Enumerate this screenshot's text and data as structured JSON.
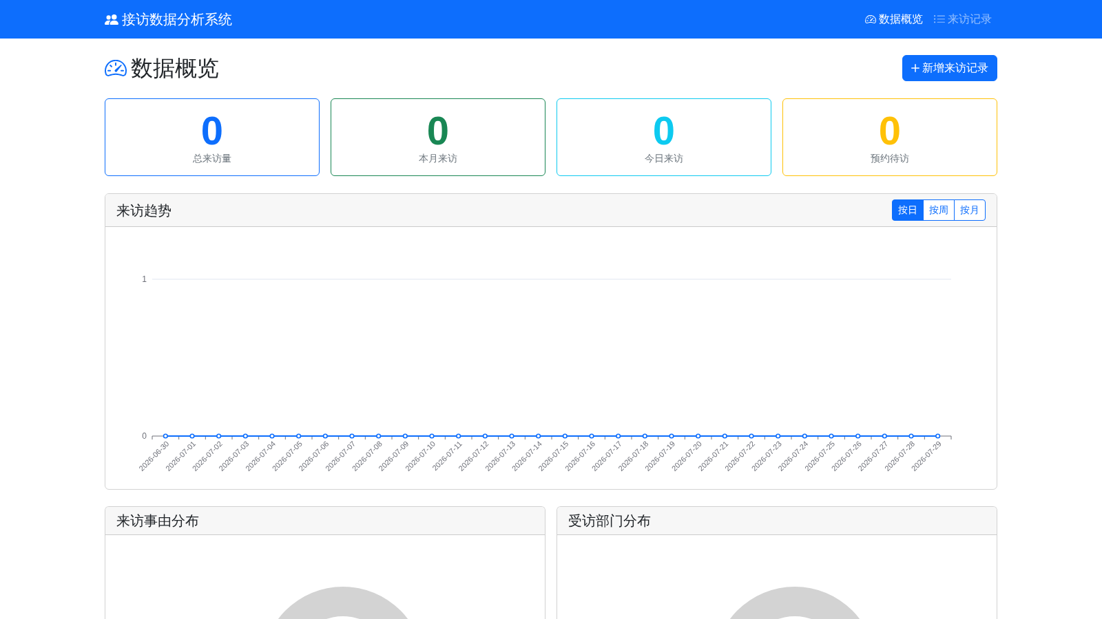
{
  "navbar": {
    "brand": "接访数据分析系统",
    "links": [
      {
        "label": "数据概览",
        "selected": true
      },
      {
        "label": "来访记录",
        "selected": false
      }
    ]
  },
  "page_header": {
    "title": "数据概览",
    "button": "新增来访记录"
  },
  "stats": [
    {
      "value": "0",
      "label": "总来访量",
      "color": "#0d6efd"
    },
    {
      "value": "0",
      "label": "本月来访",
      "color": "#198754"
    },
    {
      "value": "0",
      "label": "今日来访",
      "color": "#0dcaf0"
    },
    {
      "value": "0",
      "label": "预约待访",
      "color": "#ffc107"
    }
  ],
  "trend_card": {
    "title": "来访趋势",
    "ranges": [
      {
        "label": "按日",
        "selected": true
      },
      {
        "label": "按周",
        "selected": false
      },
      {
        "label": "按月",
        "selected": false
      }
    ],
    "chart_data": {
      "type": "line",
      "categories": [
        "2026-06-30",
        "2026-07-01",
        "2026-07-02",
        "2026-07-03",
        "2026-07-04",
        "2026-07-05",
        "2026-07-06",
        "2026-07-07",
        "2026-07-08",
        "2026-07-09",
        "2026-07-10",
        "2026-07-11",
        "2026-07-12",
        "2026-07-13",
        "2026-07-14",
        "2026-07-15",
        "2026-07-16",
        "2026-07-17",
        "2026-07-18",
        "2026-07-19",
        "2026-07-20",
        "2026-07-21",
        "2026-07-22",
        "2026-07-23",
        "2026-07-24",
        "2026-07-25",
        "2026-07-26",
        "2026-07-27",
        "2026-07-28",
        "2026-07-29"
      ],
      "series": [
        {
          "color": "#0d6efd",
          "marker": true,
          "values": [
            0,
            0,
            0,
            0,
            0,
            0,
            0,
            0,
            0,
            0,
            0,
            0,
            0,
            0,
            0,
            0,
            0,
            0,
            0,
            0,
            0,
            0,
            0,
            0,
            0,
            0,
            0,
            0,
            0,
            0
          ]
        }
      ],
      "ylim": [
        0,
        1
      ],
      "yticks": [
        0,
        1
      ]
    }
  },
  "distribution_cards": [
    {
      "title": "来访事由分布"
    },
    {
      "title": "受访部门分布"
    }
  ]
}
